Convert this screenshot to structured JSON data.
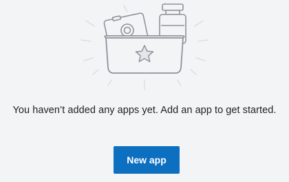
{
  "empty_state": {
    "illustration": "basket-with-camera-and-jar-star-icon",
    "message": "You haven’t added any apps yet. Add an app to get started.",
    "button_label": "New app"
  },
  "colors": {
    "background": "#f3f4f6",
    "button": "#0d6fc0",
    "illustration_stroke": "#8e939a",
    "ray": "#dcdee2"
  }
}
